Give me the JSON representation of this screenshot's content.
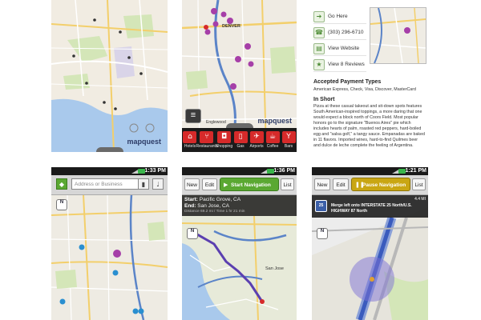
{
  "screen1": {
    "brand": "mapquest"
  },
  "screen2": {
    "brand": "mapquest",
    "map_labels": {
      "denver": "DENVER",
      "englewood": "Englewood"
    },
    "categories": [
      {
        "label": "Hotels",
        "icon": "bed-icon",
        "glyph": "⌂"
      },
      {
        "label": "Restaurants",
        "icon": "fork-knife-icon",
        "glyph": "⑂"
      },
      {
        "label": "Shopping",
        "icon": "shopping-bag-icon",
        "glyph": "◘"
      },
      {
        "label": "Gas",
        "icon": "gas-pump-icon",
        "glyph": "▯"
      },
      {
        "label": "Airports",
        "icon": "airplane-icon",
        "glyph": "✈"
      },
      {
        "label": "Coffee",
        "icon": "coffee-cup-icon",
        "glyph": "☕"
      },
      {
        "label": "Bars",
        "icon": "cocktail-icon",
        "glyph": "Y"
      }
    ]
  },
  "screen3": {
    "actions": [
      {
        "label": "Go Here",
        "icon": "car-icon",
        "glyph": "➔"
      },
      {
        "label": "(303) 296-6710",
        "icon": "phone-icon",
        "glyph": "☎"
      },
      {
        "label": "View Website",
        "icon": "globe-icon",
        "glyph": "▤"
      },
      {
        "label": "View 8 Reviews",
        "icon": "star-icon",
        "glyph": "★"
      }
    ],
    "payment_title": "Accepted Payment Types",
    "payment_text": "American Express, Check, Visa, Discover, MasterCard",
    "in_short_title": "In Short",
    "in_short_text": "Pizza at these casual takeout and sit-down spots features South American-inspired toppings, a more daring that one would expect a block north of Coors Field. Most popular honors go to the signature \"Buenos Aires\" pie which includes hearts of palm, roasted red peppers, hard-boiled egg and \"salsa golf,\" a tangy sauce. Empanadas are baked in 11 flavors. Imported wines, hard-to-find Quilmes beer and dulce de leche complete the feeling of Argentina."
  },
  "screen4": {
    "time": "1:33 PM",
    "search_placeholder": "Address or Business",
    "compass_label": "N"
  },
  "screen5": {
    "time": "1:36 PM",
    "new_label": "New",
    "edit_label": "Edit",
    "start_nav_label": "Start Navigation",
    "list_label": "List",
    "start_key": "Start:",
    "start_value": "Pacific Grove, CA",
    "end_key": "End:",
    "end_value": "San Jose, CA",
    "summary": "Distance 69.2 mi / Time 1 hr 21 min",
    "compass_label": "N",
    "map_labels": {
      "san_jose": "San Jose"
    }
  },
  "screen6": {
    "time": "1:21 PM",
    "new_label": "New",
    "edit_label": "Edit",
    "pause_nav_label": "Pause Navigation",
    "list_label": "List",
    "shield": "25",
    "distance": "4.4 MI",
    "instruction": "Merge left onto INTERSTATE 25 North/U.S. HIGHWAY 87 North",
    "compass_label": "N"
  },
  "colors": {
    "pin_purple": "#a63fa8",
    "pin_blue": "#2a8fd0",
    "nav_green": "#5aa832",
    "nav_yellow": "#c9a613",
    "category_red": "#d62a2a",
    "route_purple": "#5b3fb0"
  }
}
